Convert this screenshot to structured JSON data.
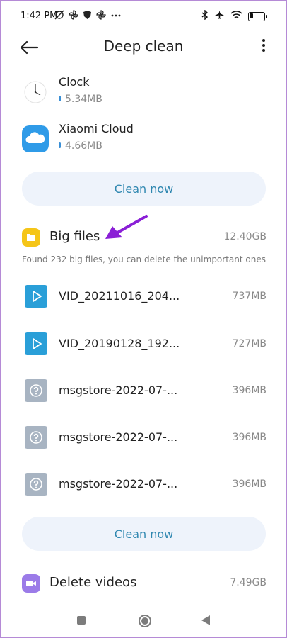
{
  "status_bar": {
    "time": "1:42 PM",
    "left_icons": [
      "no-alarm-icon",
      "pinwheel-icon",
      "shield-icon",
      "pinwheel-icon",
      "more-dots-icon"
    ],
    "right_icons": [
      "bluetooth-icon",
      "airplane-icon",
      "wifi-icon",
      "battery-icon"
    ]
  },
  "header": {
    "title": "Deep clean"
  },
  "apps": [
    {
      "name": "Clock",
      "size": "5.34MB",
      "icon": "clock-icon"
    },
    {
      "name": "Xiaomi Cloud",
      "size": "4.66MB",
      "icon": "cloud-icon",
      "color": "#2f9be8"
    }
  ],
  "buttons": {
    "clean_now_1": "Clean now",
    "clean_now_2": "Clean now"
  },
  "big_files": {
    "title": "Big files",
    "size": "12.40GB",
    "description": "Found 232 big files, you can delete the unimportant ones",
    "icon_color": "#f5c518",
    "files": [
      {
        "name": "VID_20211016_204...",
        "size": "737MB",
        "type": "video",
        "icon": "play-icon",
        "color": "#2a9fd8"
      },
      {
        "name": "VID_20190128_192...",
        "size": "727MB",
        "type": "video",
        "icon": "play-icon",
        "color": "#2a9fd8"
      },
      {
        "name": "msgstore-2022-07-...",
        "size": "396MB",
        "type": "unknown",
        "icon": "question-icon",
        "color": "#a8b4c2"
      },
      {
        "name": "msgstore-2022-07-...",
        "size": "396MB",
        "type": "unknown",
        "icon": "question-icon",
        "color": "#a8b4c2"
      },
      {
        "name": "msgstore-2022-07-...",
        "size": "396MB",
        "type": "unknown",
        "icon": "question-icon",
        "color": "#a8b4c2"
      }
    ]
  },
  "delete_videos": {
    "title": "Delete videos",
    "size": "7.49GB",
    "icon_color": "#9b7be8"
  },
  "annotation": {
    "arrow_color": "#8a1fd6"
  }
}
